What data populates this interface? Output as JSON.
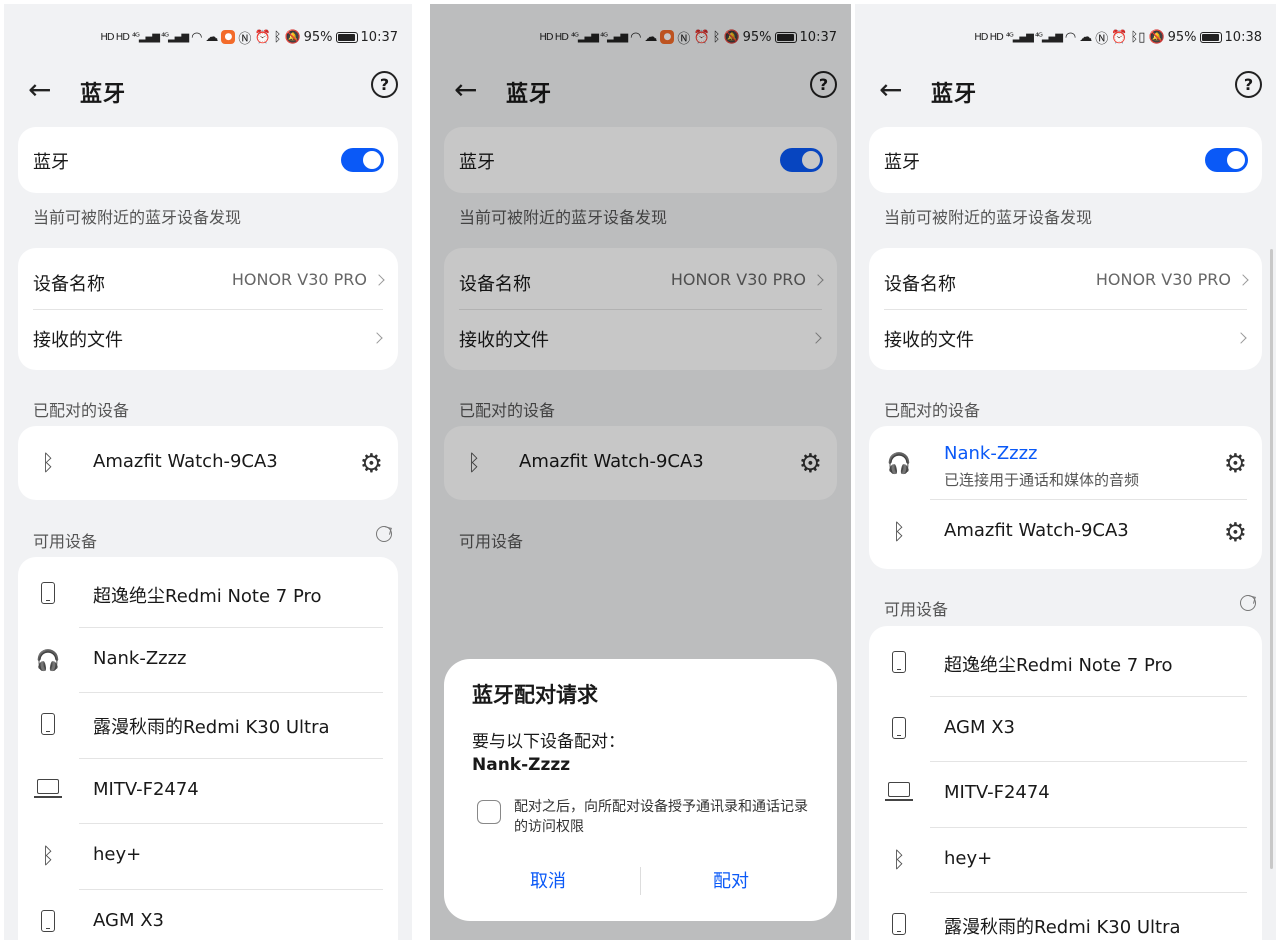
{
  "status_bars": [
    {
      "time": "10:37",
      "battery": "95%"
    },
    {
      "time": "10:37",
      "battery": "95%"
    },
    {
      "time": "10:38",
      "battery": "95%"
    }
  ],
  "page_title": "蓝牙",
  "bluetooth_label": "蓝牙",
  "bluetooth_on": true,
  "discoverable_text": "当前可被附近的蓝牙设备发现",
  "device_name_label": "设备名称",
  "device_name_value": "HONOR V30 PRO",
  "received_files_label": "接收的文件",
  "paired_header": "已配对的设备",
  "available_header": "可用设备",
  "panel1": {
    "paired": [
      {
        "name": "Amazfit Watch-9CA3",
        "icon": "bluetooth-icon"
      }
    ],
    "available": [
      {
        "name": "超逸绝尘Redmi Note 7 Pro",
        "icon": "phone-icon"
      },
      {
        "name": "Nank-Zzzz",
        "icon": "headphones-icon"
      },
      {
        "name": "露漫秋雨的Redmi K30 Ultra",
        "icon": "phone-icon"
      },
      {
        "name": "MITV-F2474",
        "icon": "laptop-icon"
      },
      {
        "name": "hey+",
        "icon": "bluetooth-icon"
      },
      {
        "name": "AGM X3",
        "icon": "phone-icon"
      }
    ]
  },
  "panel2": {
    "paired": [
      {
        "name": "Amazfit Watch-9CA3",
        "icon": "bluetooth-icon"
      }
    ],
    "dialog": {
      "title": "蓝牙配对请求",
      "message": "要与以下设备配对：",
      "device": "Nank-Zzzz",
      "checkbox_text": "配对之后，向所配对设备授予通讯录和通话记录的访问权限",
      "checkbox_checked": false,
      "cancel": "取消",
      "confirm": "配对",
      "accent": "#0a59f7"
    }
  },
  "panel3": {
    "paired": [
      {
        "name": "Nank-Zzzz",
        "status": "已连接用于通话和媒体的音频",
        "icon": "headphones-icon"
      },
      {
        "name": "Amazfit Watch-9CA3",
        "icon": "bluetooth-icon"
      }
    ],
    "available": [
      {
        "name": "超逸绝尘Redmi Note 7 Pro",
        "icon": "phone-icon"
      },
      {
        "name": "AGM X3",
        "icon": "phone-icon"
      },
      {
        "name": "MITV-F2474",
        "icon": "laptop-icon"
      },
      {
        "name": "hey+",
        "icon": "bluetooth-icon"
      },
      {
        "name": "露漫秋雨的Redmi K30 Ultra",
        "icon": "phone-icon"
      }
    ]
  },
  "colors": {
    "accent": "#0a59f7",
    "background": "#f1f2f4",
    "card": "#ffffff"
  }
}
